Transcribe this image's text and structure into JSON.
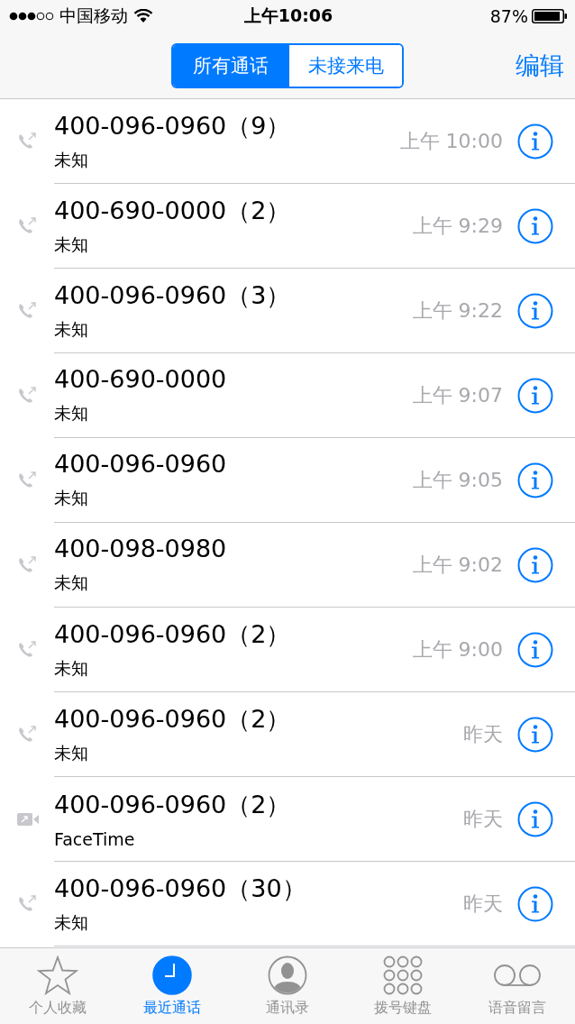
{
  "status_bar": {
    "carrier": "中国移动",
    "time": "上午10:06",
    "battery": "87%"
  },
  "segments": [
    {
      "label": "所有通话",
      "selected": true
    },
    {
      "label": "未接来电",
      "selected": false
    }
  ],
  "edit_button": "编辑",
  "calls": [
    {
      "kind": "phone",
      "number": "400-096-0960（9）",
      "label": "未知",
      "time": "上午 10:00"
    },
    {
      "kind": "phone",
      "number": "400-690-0000（2）",
      "label": "未知",
      "time": "上午 9:29"
    },
    {
      "kind": "phone",
      "number": "400-096-0960（3）",
      "label": "未知",
      "time": "上午 9:22"
    },
    {
      "kind": "phone",
      "number": "400-690-0000",
      "label": "未知",
      "time": "上午 9:07"
    },
    {
      "kind": "phone",
      "number": "400-096-0960",
      "label": "未知",
      "time": "上午 9:05"
    },
    {
      "kind": "phone",
      "number": "400-098-0980",
      "label": "未知",
      "time": "上午 9:02"
    },
    {
      "kind": "phone",
      "number": "400-096-0960（2）",
      "label": "未知",
      "time": "上午 9:00"
    },
    {
      "kind": "phone",
      "number": "400-096-0960（2）",
      "label": "未知",
      "time": "昨天"
    },
    {
      "kind": "video",
      "number": "400-096-0960（2）",
      "label": "FaceTime",
      "time": "昨天"
    },
    {
      "kind": "phone",
      "number": "400-096-0960（30）",
      "label": "未知",
      "time": "昨天"
    }
  ],
  "tab_bar": [
    {
      "kind": "star",
      "label": "个人收藏",
      "selected": false
    },
    {
      "kind": "clock",
      "label": "最近通话",
      "selected": true
    },
    {
      "kind": "person",
      "label": "通讯录",
      "selected": false
    },
    {
      "kind": "keypad",
      "label": "拨号键盘",
      "selected": false
    },
    {
      "kind": "voicemail",
      "label": "语音留言",
      "selected": false
    }
  ]
}
